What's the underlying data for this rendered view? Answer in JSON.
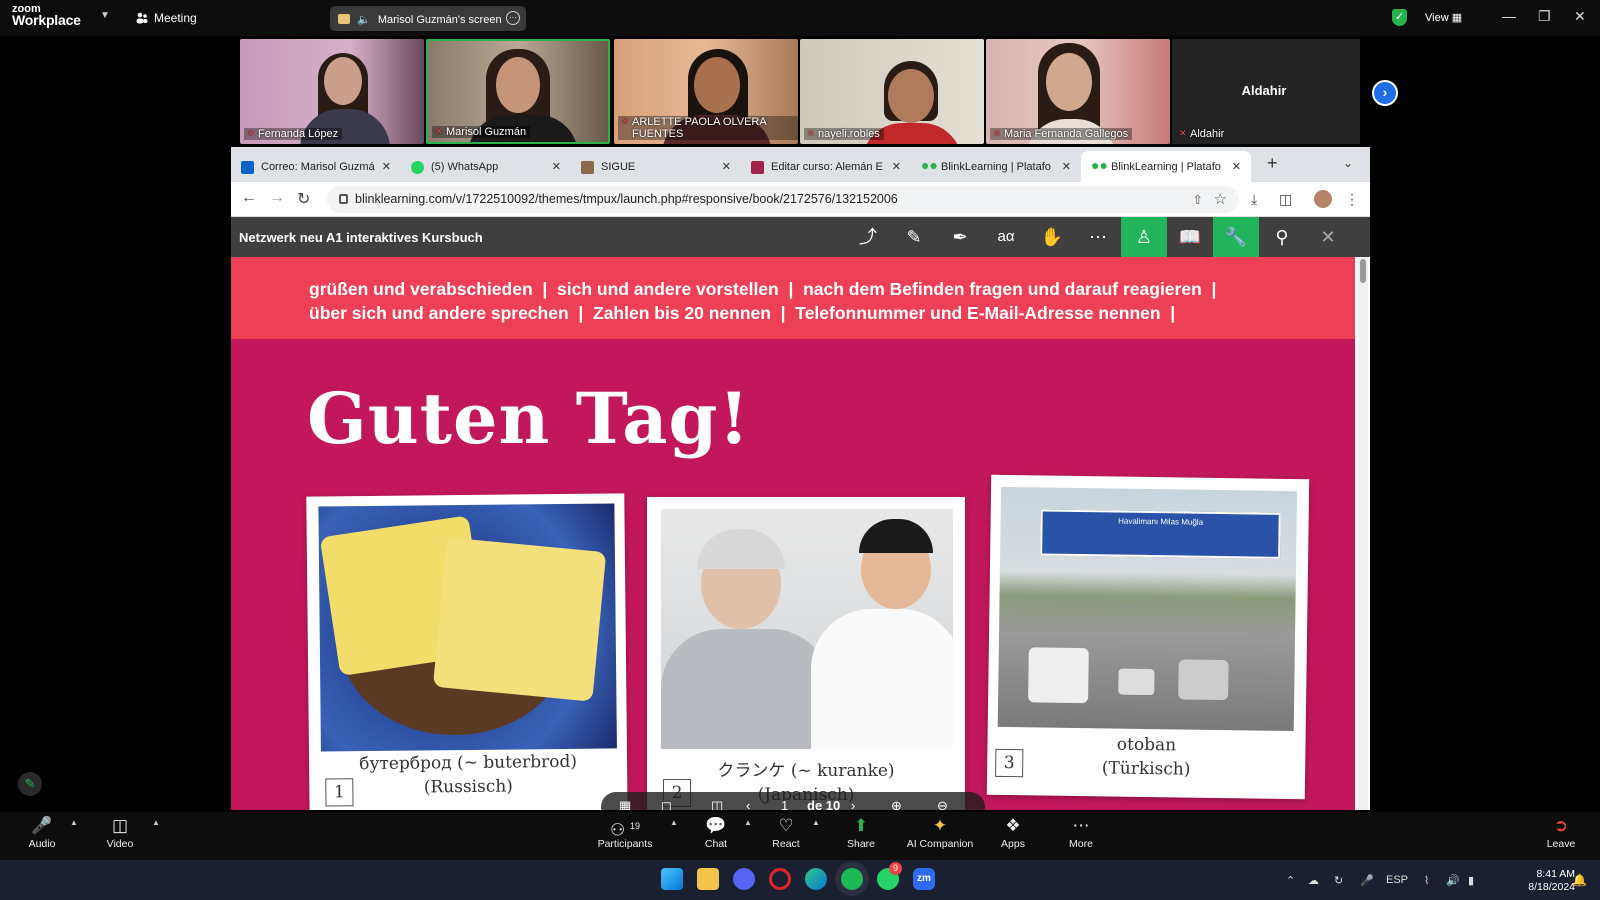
{
  "zoom": {
    "logo_top": "zoom",
    "logo_bottom": "Workplace",
    "meeting_label": "Meeting",
    "screen_share_label": "Marisol Guzmán's screen",
    "view_label": "View",
    "gallery_participants": [
      {
        "name": "Fernanda López"
      },
      {
        "name": "Marisol Guzmán"
      },
      {
        "name": "ARLETTE PAOLA OLVERA FUENTES"
      },
      {
        "name": "nayeli.robles"
      },
      {
        "name": "Maria Fernanda Gallegos"
      },
      {
        "name": "Aldahir"
      }
    ],
    "aldahir_center_name": "Aldahir",
    "participants_count": "19",
    "controls": {
      "audio": "Audio",
      "video": "Video",
      "participants": "Participants",
      "chat": "Chat",
      "react": "React",
      "share": "Share",
      "ai_companion": "AI Companion",
      "apps": "Apps",
      "more": "More",
      "leave": "Leave"
    }
  },
  "browser": {
    "tabs": [
      {
        "title": "Correo: Marisol Guzmá",
        "fav_color": "#0a64c8"
      },
      {
        "title": "(5) WhatsApp",
        "fav_color": "#25d366"
      },
      {
        "title": "SIGUE",
        "fav_color": "#8a6a4a"
      },
      {
        "title": "Editar curso: Alemán E",
        "fav_color": "#a1234b"
      },
      {
        "title": "BlinkLearning | Platafo",
        "fav_color": "#2bb24c"
      },
      {
        "title": "BlinkLearning | Platafo",
        "fav_color": "#2bb24c"
      }
    ],
    "url": "blinklearning.com/v/1722510092/themes/tmpux/launch.php#responsive/book/2172576/132152006"
  },
  "book": {
    "title": "Netzwerk neu A1 interaktives Kursbuch",
    "topics_line1": "grüßen und verabschieden  |  sich und andere vorstellen  |  nach dem Befinden fragen und darauf reagieren  |",
    "topics_line2": "über sich und andere sprechen  |  Zahlen bis 20 nennen  |  Telefonnummer und E-Mail-Adresse nennen  |",
    "headline": "Guten Tag!",
    "cards": [
      {
        "number": "1",
        "caption1": "бутерброд (~ buterbrod)",
        "caption2": "(Russisch)"
      },
      {
        "number": "2",
        "caption1": "クランケ (~ kuranke)",
        "caption2": "(Japanisch)"
      },
      {
        "number": "3",
        "caption1": "otoban",
        "caption2": "(Türkisch)"
      }
    ],
    "sign_text": "Havalimanı Milas Muğla",
    "pager": {
      "current": "1",
      "of": "de 10"
    }
  },
  "taskbar": {
    "lang": "ESP",
    "time": "8:41 AM",
    "date": "8/18/2024",
    "whatsapp_badge": "9"
  }
}
